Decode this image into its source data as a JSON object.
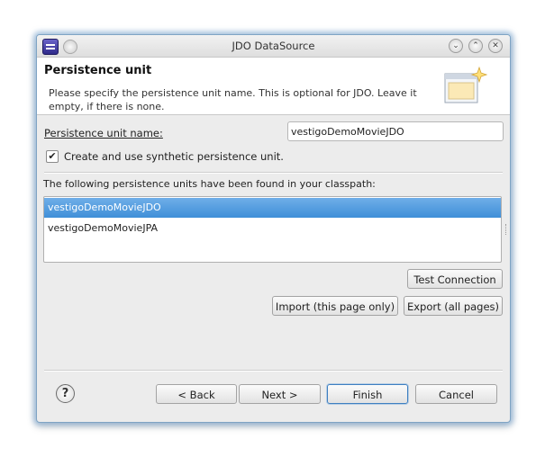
{
  "window": {
    "title": "JDO DataSource",
    "controls": {
      "minimize": "⌄",
      "maximize": "⌃",
      "close": "✕"
    }
  },
  "banner": {
    "title": "Persistence unit",
    "description": "Please specify the persistence unit name. This is optional for JDO. Leave it empty, if there is none.",
    "icon": "wizard-banner-icon"
  },
  "form": {
    "name_label": "Persistence unit name:",
    "name_value": "vestigoDemoMovieJDO",
    "synthetic_checkbox": {
      "checked": true,
      "mark": "✔",
      "label": "Create and use synthetic persistence unit."
    }
  },
  "units": {
    "caption": "The following persistence units have been found in your classpath:",
    "items": [
      {
        "label": "vestigoDemoMovieJDO",
        "selected": true
      },
      {
        "label": "vestigoDemoMovieJPA",
        "selected": false
      }
    ]
  },
  "actions": {
    "test_connection": "Test Connection",
    "import": "Import (this page only)",
    "export": "Export (all pages)"
  },
  "footer": {
    "help": "?",
    "back": "< Back",
    "next": "Next >",
    "finish": "Finish",
    "cancel": "Cancel"
  },
  "colors": {
    "selection": "#4a96dd",
    "window_border": "#7fa4c4",
    "default_button_border": "#3e7fc1"
  }
}
